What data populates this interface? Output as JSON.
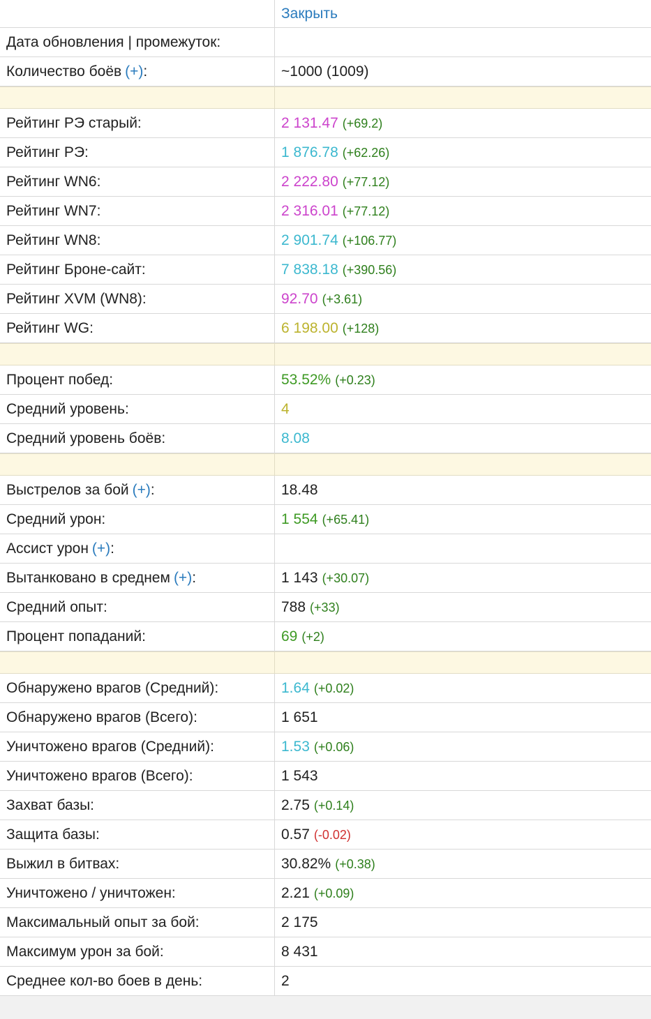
{
  "header": {
    "close_label": "Закрыть"
  },
  "colors": {
    "magenta": "#cc44cc",
    "cyan": "#3cb8cf",
    "yellow": "#bcb32e",
    "green": "#3e9a24",
    "delta_green": "#2e7f1c",
    "delta_red": "#d03030",
    "plain": "#212121",
    "link": "#2a7bbd"
  },
  "rows": [
    {
      "type": "row",
      "label": "Дата обновления | промежуток:",
      "value": "",
      "value_color": "plain",
      "delta": "",
      "delta_color": ""
    },
    {
      "type": "row",
      "label": "Количество боёв",
      "plus": "(+)",
      "suffix": ":",
      "value": "~1000 (1009)",
      "value_color": "plain",
      "delta": "",
      "delta_color": ""
    },
    {
      "type": "spacer"
    },
    {
      "type": "row",
      "label": "Рейтинг РЭ старый:",
      "value": "2 131.47",
      "value_color": "magenta",
      "delta": "(+69.2)",
      "delta_color": "delta_green"
    },
    {
      "type": "row",
      "label": "Рейтинг РЭ:",
      "value": "1 876.78",
      "value_color": "cyan",
      "delta": "(+62.26)",
      "delta_color": "delta_green"
    },
    {
      "type": "row",
      "label": "Рейтинг WN6:",
      "value": "2 222.80",
      "value_color": "magenta",
      "delta": "(+77.12)",
      "delta_color": "delta_green"
    },
    {
      "type": "row",
      "label": "Рейтинг WN7:",
      "value": "2 316.01",
      "value_color": "magenta",
      "delta": "(+77.12)",
      "delta_color": "delta_green"
    },
    {
      "type": "row",
      "label": "Рейтинг WN8:",
      "value": "2 901.74",
      "value_color": "cyan",
      "delta": "(+106.77)",
      "delta_color": "delta_green"
    },
    {
      "type": "row",
      "label": "Рейтинг Броне-сайт:",
      "value": "7 838.18",
      "value_color": "cyan",
      "delta": "(+390.56)",
      "delta_color": "delta_green"
    },
    {
      "type": "row",
      "label": "Рейтинг XVM (WN8):",
      "value": "92.70",
      "value_color": "magenta",
      "delta": "(+3.61)",
      "delta_color": "delta_green"
    },
    {
      "type": "row",
      "label": "Рейтинг WG:",
      "value": "6 198.00",
      "value_color": "yellow",
      "delta": "(+128)",
      "delta_color": "delta_green"
    },
    {
      "type": "spacer"
    },
    {
      "type": "row",
      "label": "Процент побед:",
      "value": "53.52%",
      "value_color": "green",
      "delta": "(+0.23)",
      "delta_color": "delta_green"
    },
    {
      "type": "row",
      "label": "Средний уровень:",
      "value": "4",
      "value_color": "yellow",
      "delta": "",
      "delta_color": ""
    },
    {
      "type": "row",
      "label": "Средний уровень боёв:",
      "value": "8.08",
      "value_color": "cyan",
      "delta": "",
      "delta_color": ""
    },
    {
      "type": "spacer"
    },
    {
      "type": "row",
      "label": "Выстрелов за бой",
      "plus": "(+)",
      "suffix": ":",
      "value": "18.48",
      "value_color": "plain",
      "delta": "",
      "delta_color": ""
    },
    {
      "type": "row",
      "label": "Средний урон:",
      "value": "1 554",
      "value_color": "green",
      "delta": "(+65.41)",
      "delta_color": "delta_green"
    },
    {
      "type": "row",
      "label": "Ассист урон",
      "plus": "(+)",
      "suffix": ":",
      "value": "",
      "value_color": "plain",
      "delta": "",
      "delta_color": ""
    },
    {
      "type": "row",
      "label": "Вытанковано в среднем",
      "plus": "(+)",
      "suffix": ":",
      "value": "1 143",
      "value_color": "plain",
      "delta": "(+30.07)",
      "delta_color": "delta_green"
    },
    {
      "type": "row",
      "label": "Средний опыт:",
      "value": "788",
      "value_color": "plain",
      "delta": "(+33)",
      "delta_color": "delta_green"
    },
    {
      "type": "row",
      "label": "Процент попаданий:",
      "value": "69",
      "value_color": "green",
      "delta": "(+2)",
      "delta_color": "delta_green"
    },
    {
      "type": "spacer"
    },
    {
      "type": "row",
      "label": "Обнаружено врагов (Средний):",
      "value": "1.64",
      "value_color": "cyan",
      "delta": "(+0.02)",
      "delta_color": "delta_green"
    },
    {
      "type": "row",
      "label": "Обнаружено врагов (Всего):",
      "value": "1 651",
      "value_color": "plain",
      "delta": "",
      "delta_color": ""
    },
    {
      "type": "row",
      "label": "Уничтожено врагов (Средний):",
      "value": "1.53",
      "value_color": "cyan",
      "delta": "(+0.06)",
      "delta_color": "delta_green"
    },
    {
      "type": "row",
      "label": "Уничтожено врагов (Всего):",
      "value": "1 543",
      "value_color": "plain",
      "delta": "",
      "delta_color": ""
    },
    {
      "type": "row",
      "label": "Захват базы:",
      "value": "2.75",
      "value_color": "plain",
      "delta": "(+0.14)",
      "delta_color": "delta_green"
    },
    {
      "type": "row",
      "label": "Защита базы:",
      "value": "0.57",
      "value_color": "plain",
      "delta": "(-0.02)",
      "delta_color": "delta_red"
    },
    {
      "type": "row",
      "label": "Выжил в битвах:",
      "value": "30.82%",
      "value_color": "plain",
      "delta": "(+0.38)",
      "delta_color": "delta_green"
    },
    {
      "type": "row",
      "label": "Уничтожено / уничтожен:",
      "value": "2.21",
      "value_color": "plain",
      "delta": "(+0.09)",
      "delta_color": "delta_green"
    },
    {
      "type": "row",
      "label": "Максимальный опыт за бой:",
      "value": "2 175",
      "value_color": "plain",
      "delta": "",
      "delta_color": ""
    },
    {
      "type": "row",
      "label": "Максимум урон за бой:",
      "value": "8 431",
      "value_color": "plain",
      "delta": "",
      "delta_color": ""
    },
    {
      "type": "row",
      "label": "Среднее кол-во боев в день:",
      "value": "2",
      "value_color": "plain",
      "delta": "",
      "delta_color": ""
    }
  ]
}
